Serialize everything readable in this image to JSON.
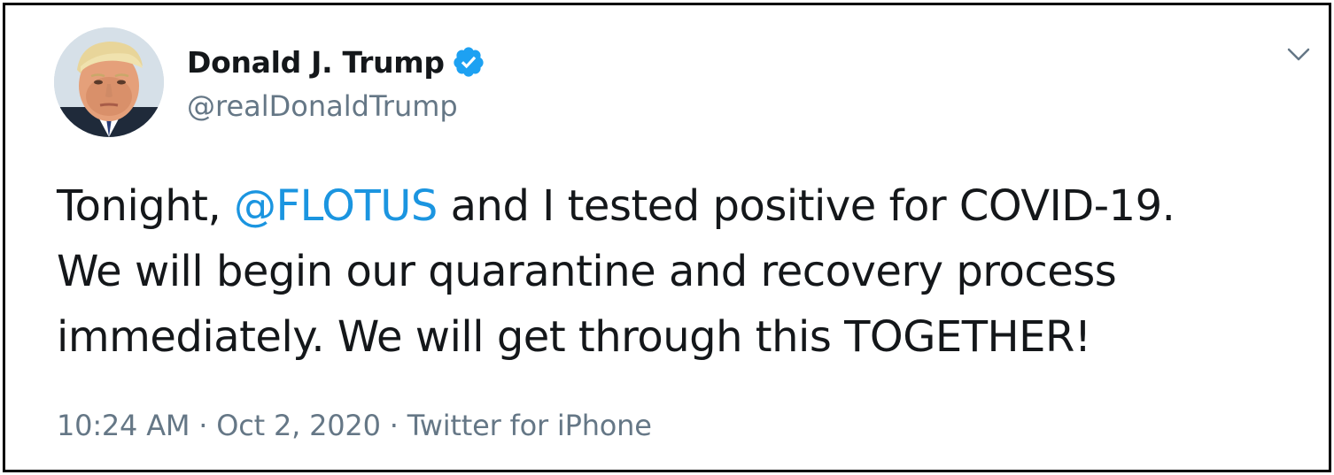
{
  "user": {
    "display_name": "Donald J. Trump",
    "handle": "@realDonaldTrump",
    "verified": true
  },
  "tweet": {
    "line1_before": "Tonight, ",
    "mention": "@FLOTUS",
    "line1_after": " and I tested positive for COVID-19.",
    "line2": "We will begin our quarantine and recovery process",
    "line3": "immediately. We will get through this TOGETHER!"
  },
  "meta": {
    "time": "10:24 AM",
    "separator": "·",
    "date": "Oct 2, 2020",
    "source": "Twitter for iPhone"
  },
  "icons": {
    "verified": "verified-badge-icon",
    "caret": "chevron-down-icon"
  },
  "colors": {
    "text": "#14171a",
    "secondary": "#657786",
    "link": "#1b95e0",
    "verified": "#1da1f2",
    "border": "#000000"
  }
}
